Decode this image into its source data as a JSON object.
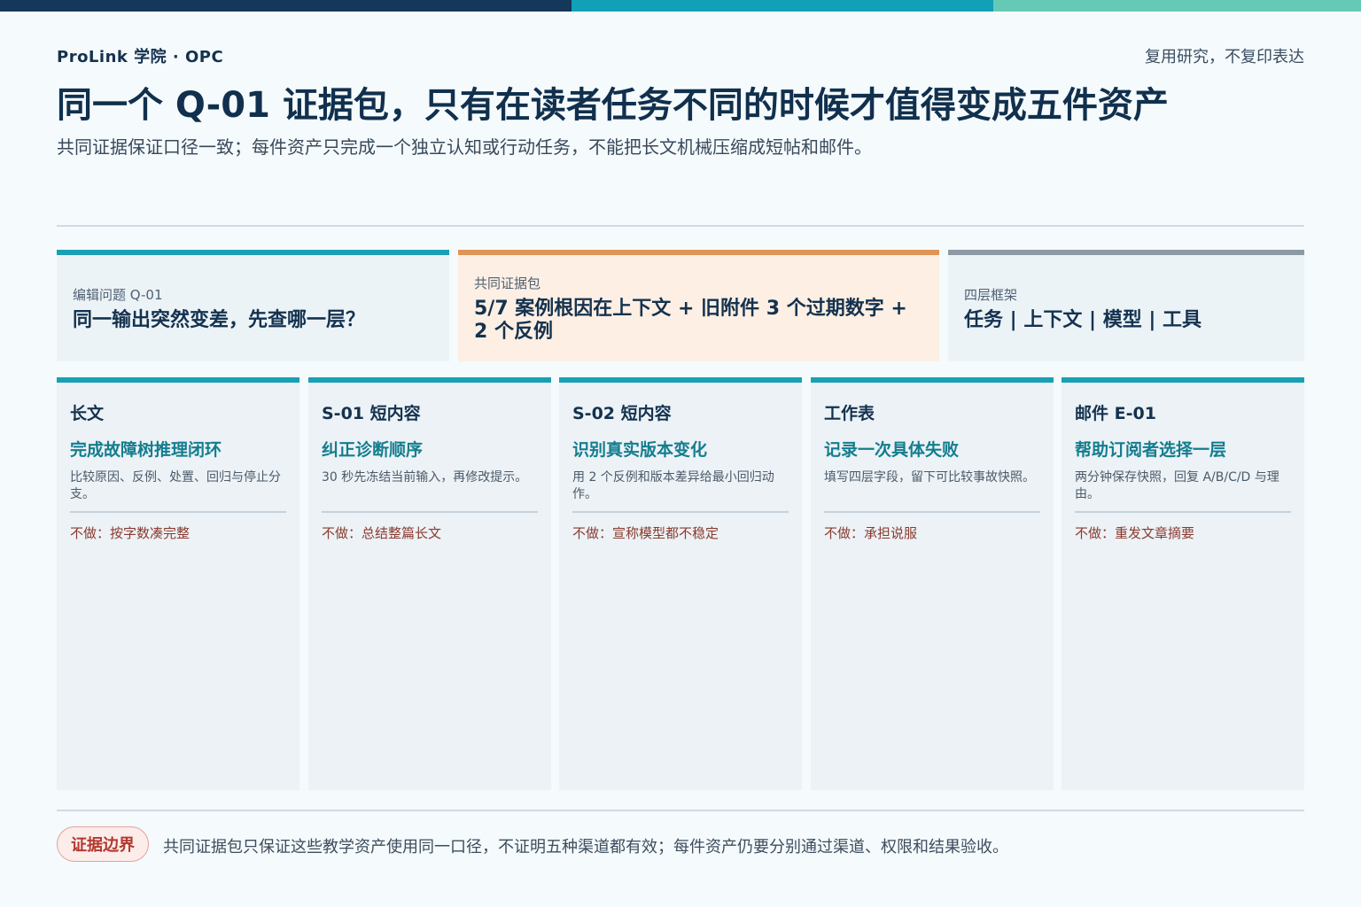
{
  "header": {
    "brand": "ProLink 学院 · OPC",
    "motto": "复用研究，不复印表达",
    "title": "同一个 Q-01 证据包，只有在读者任务不同的时候才值得变成五件资产",
    "subtitle": "共同证据保证口径一致；每件资产只完成一个独立认知或行动任务，不能把长文机械压缩成短帖和邮件。"
  },
  "infoboxes": [
    {
      "label": "编辑问题 Q-01",
      "value": "同一输出突然变差，先查哪一层？"
    },
    {
      "label": "共同证据包",
      "value": "5/7 案例根因在上下文 + 旧附件 3 个过期数字 + 2 个反例"
    },
    {
      "label": "四层框架",
      "value": "任务 | 上下文 | 模型 | 工具"
    }
  ],
  "cards": [
    {
      "title": "长文",
      "task": "完成故障树推理闭环",
      "desc": "比较原因、反例、处置、回归与停止分支。",
      "not": "不做：按字数凑完整"
    },
    {
      "title": "S-01 短内容",
      "task": "纠正诊断顺序",
      "desc": "30 秒先冻结当前输入，再修改提示。",
      "not": "不做：总结整篇长文"
    },
    {
      "title": "S-02 短内容",
      "task": "识别真实版本变化",
      "desc": "用 2 个反例和版本差异给最小回归动作。",
      "not": "不做：宣称模型都不稳定"
    },
    {
      "title": "工作表",
      "task": "记录一次具体失败",
      "desc": "填写四层字段，留下可比较事故快照。",
      "not": "不做：承担说服"
    },
    {
      "title": "邮件 E-01",
      "task": "帮助订阅者选择一层",
      "desc": "两分钟保存快照，回复 A/B/C/D 与理由。",
      "not": "不做：重发文章摘要"
    }
  ],
  "footer": {
    "badge": "证据边界",
    "note": "共同证据包只保证这些教学资产使用同一口径，不证明五种渠道都有效；每件资产仍要分别通过渠道、权限和结果验收。"
  },
  "colors": {
    "navy": "#14375a",
    "teal": "#11a0b5",
    "mint": "#66c9b5",
    "orange": "#e09556",
    "gray": "#8e9aa3",
    "red": "#b2392d"
  }
}
